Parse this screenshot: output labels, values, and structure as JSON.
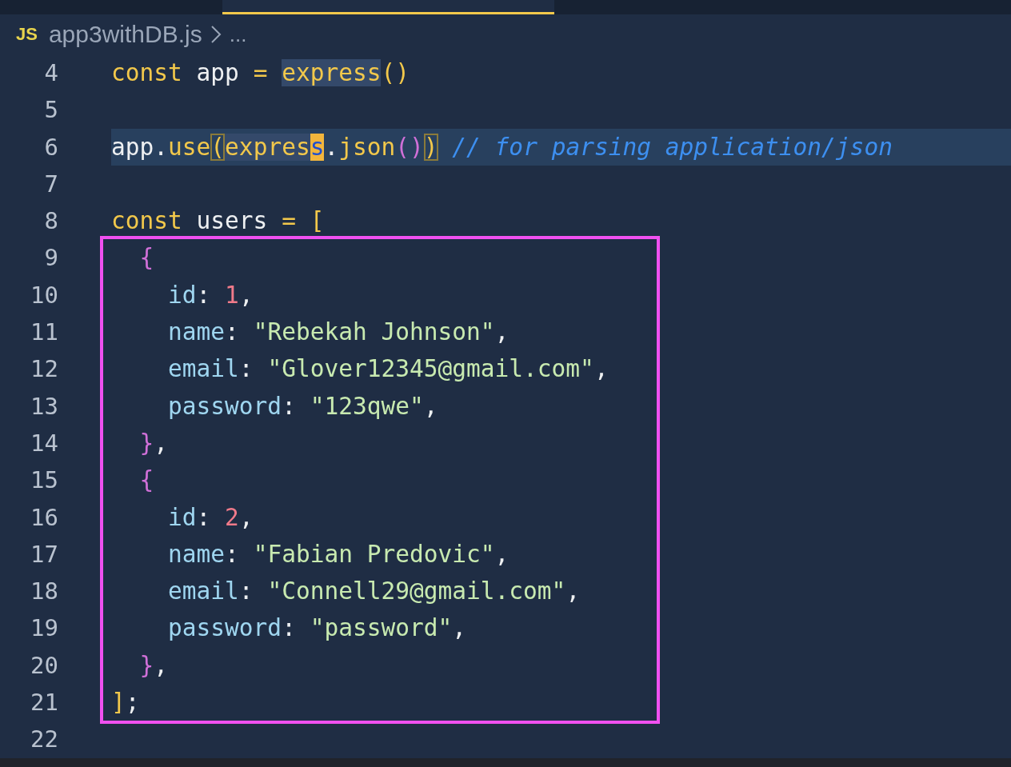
{
  "breadcrumb": {
    "file_badge": "JS",
    "file_name": "app3withDB.js",
    "ellipsis": "..."
  },
  "lines": [
    {
      "number": "4",
      "current": false,
      "boxed": false,
      "tokens": [
        {
          "text": "const ",
          "kind": "keyword"
        },
        {
          "text": "app ",
          "kind": "variable"
        },
        {
          "text": "= ",
          "kind": "keyword"
        },
        {
          "text": "express",
          "kind": "selection"
        },
        {
          "text": "()",
          "kind": "function"
        }
      ]
    },
    {
      "number": "5",
      "current": false,
      "boxed": false
    },
    {
      "number": "6",
      "current": true,
      "boxed": false,
      "tokens": [
        {
          "text": "app.",
          "kind": "variable"
        },
        {
          "text": "use",
          "kind": "function"
        },
        {
          "text": "(",
          "kind": "match"
        },
        {
          "text": "expres",
          "kind": "selection"
        },
        {
          "text": "s",
          "kind": "cursor"
        },
        {
          "text": ".",
          "kind": "variable"
        },
        {
          "text": "json",
          "kind": "function"
        },
        {
          "text": "()",
          "kind": "brace"
        },
        {
          "text": ")",
          "kind": "match"
        },
        {
          "text": " // for parsing application/json",
          "kind": "comment"
        }
      ]
    },
    {
      "number": "7",
      "current": false,
      "boxed": false
    },
    {
      "number": "8",
      "current": false,
      "boxed": false,
      "tokens": [
        {
          "text": "const ",
          "kind": "keyword"
        },
        {
          "text": "users ",
          "kind": "variable"
        },
        {
          "text": "= [",
          "kind": "keyword"
        }
      ]
    },
    {
      "number": "9",
      "current": false,
      "boxed": true,
      "tokens": [
        {
          "text": "  {",
          "kind": "brace"
        }
      ]
    },
    {
      "number": "10",
      "current": false,
      "boxed": true,
      "tokens": [
        {
          "text": "    id",
          "kind": "property"
        },
        {
          "text": ": ",
          "kind": "variable"
        },
        {
          "text": "1",
          "kind": "number"
        },
        {
          "text": ",",
          "kind": "variable"
        }
      ]
    },
    {
      "number": "11",
      "current": false,
      "boxed": true,
      "tokens": [
        {
          "text": "    name",
          "kind": "property"
        },
        {
          "text": ": ",
          "kind": "variable"
        },
        {
          "text": "\"Rebekah Johnson\"",
          "kind": "string"
        },
        {
          "text": ",",
          "kind": "variable"
        }
      ]
    },
    {
      "number": "12",
      "current": false,
      "boxed": true,
      "tokens": [
        {
          "text": "    email",
          "kind": "property"
        },
        {
          "text": ": ",
          "kind": "variable"
        },
        {
          "text": "\"Glover12345@gmail.com\"",
          "kind": "string"
        },
        {
          "text": ",",
          "kind": "variable"
        }
      ]
    },
    {
      "number": "13",
      "current": false,
      "boxed": true,
      "tokens": [
        {
          "text": "    password",
          "kind": "property"
        },
        {
          "text": ": ",
          "kind": "variable"
        },
        {
          "text": "\"123qwe\"",
          "kind": "string"
        },
        {
          "text": ",",
          "kind": "variable"
        }
      ]
    },
    {
      "number": "14",
      "current": false,
      "boxed": true,
      "tokens": [
        {
          "text": "  }",
          "kind": "brace"
        },
        {
          "text": ",",
          "kind": "variable"
        }
      ]
    },
    {
      "number": "15",
      "current": false,
      "boxed": true,
      "tokens": [
        {
          "text": "  {",
          "kind": "brace"
        }
      ]
    },
    {
      "number": "16",
      "current": false,
      "boxed": true,
      "tokens": [
        {
          "text": "    id",
          "kind": "property"
        },
        {
          "text": ": ",
          "kind": "variable"
        },
        {
          "text": "2",
          "kind": "number"
        },
        {
          "text": ",",
          "kind": "variable"
        }
      ]
    },
    {
      "number": "17",
      "current": false,
      "boxed": true,
      "tokens": [
        {
          "text": "    name",
          "kind": "property"
        },
        {
          "text": ": ",
          "kind": "variable"
        },
        {
          "text": "\"Fabian Predovic\"",
          "kind": "string"
        },
        {
          "text": ",",
          "kind": "variable"
        }
      ]
    },
    {
      "number": "18",
      "current": false,
      "boxed": true,
      "tokens": [
        {
          "text": "    email",
          "kind": "property"
        },
        {
          "text": ": ",
          "kind": "variable"
        },
        {
          "text": "\"Connell29@gmail.com\"",
          "kind": "string"
        },
        {
          "text": ",",
          "kind": "variable"
        }
      ]
    },
    {
      "number": "19",
      "current": false,
      "boxed": true,
      "tokens": [
        {
          "text": "    password",
          "kind": "property"
        },
        {
          "text": ": ",
          "kind": "variable"
        },
        {
          "text": "\"password\"",
          "kind": "string"
        },
        {
          "text": ",",
          "kind": "variable"
        }
      ]
    },
    {
      "number": "20",
      "current": false,
      "boxed": true,
      "tokens": [
        {
          "text": "  }",
          "kind": "brace"
        },
        {
          "text": ",",
          "kind": "variable"
        }
      ]
    },
    {
      "number": "21",
      "current": false,
      "boxed": true,
      "tokens": [
        {
          "text": "]",
          "kind": "function"
        },
        {
          "text": ";",
          "kind": "variable"
        }
      ]
    },
    {
      "number": "22",
      "current": false,
      "boxed": false
    }
  ]
}
